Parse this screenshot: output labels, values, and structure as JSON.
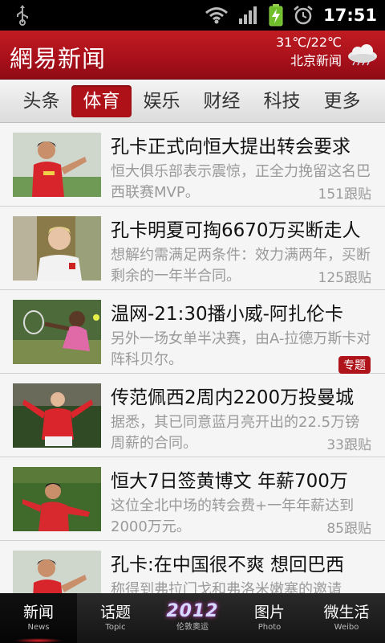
{
  "status_bar": {
    "time": "17:51"
  },
  "header": {
    "logo": "網易新闻",
    "temperature": "31℃/22℃",
    "city_news": "北京新闻"
  },
  "tabs": [
    {
      "label": "头条",
      "active": false
    },
    {
      "label": "体育",
      "active": true
    },
    {
      "label": "娱乐",
      "active": false
    },
    {
      "label": "财经",
      "active": false
    },
    {
      "label": "科技",
      "active": false
    },
    {
      "label": "更多",
      "active": false
    }
  ],
  "news": [
    {
      "title": "孔卡正式向恒大提出转会要求",
      "desc": "恒大俱乐部表示震惊，正全力挽留这名巴西联赛MVP。",
      "count": "151跟贴"
    },
    {
      "title": "孔卡明夏可掏6670万买断走人",
      "desc": "想解约需满足两条件：效力满两年，买断剩余的一年半合同。",
      "count": "125跟贴"
    },
    {
      "title": "温网-21:30播小威-阿扎伦卡",
      "desc": "另外一场女单半决赛，由A-拉德万斯卡对阵科贝尔。",
      "badge": "专题"
    },
    {
      "title": "传范佩西2周内2200万投曼城",
      "desc": "据悉，其已同意蓝月亮开出的22.5万镑周薪的合同。",
      "count": "33跟贴"
    },
    {
      "title": "恒大7日签黄博文 年薪700万",
      "desc": "这位全北中场的转会费+一年年薪达到2000万元。",
      "count": "85跟贴"
    },
    {
      "title": "孔卡:在中国很不爽 想回巴西",
      "desc": "称得到弗拉门戈和弗洛米嫩塞的邀请",
      "count": ""
    }
  ],
  "bottom_nav": [
    {
      "label": "新闻",
      "sub": "News",
      "active": true
    },
    {
      "label": "话题",
      "sub": "Topic",
      "active": false
    },
    {
      "label": "2012",
      "sub": "伦敦奥运",
      "active": false
    },
    {
      "label": "图片",
      "sub": "Photo",
      "active": false
    },
    {
      "label": "微生活",
      "sub": "Weibo",
      "active": false
    }
  ]
}
